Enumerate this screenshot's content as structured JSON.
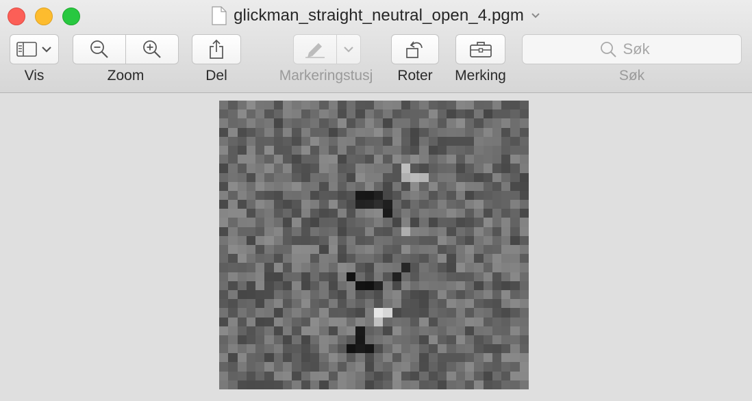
{
  "window": {
    "title": "glickman_straight_neutral_open_4.pgm"
  },
  "toolbar": {
    "vis_label": "Vis",
    "zoom_label": "Zoom",
    "del_label": "Del",
    "markup_pen_label": "Markeringstusj",
    "rotate_label": "Roter",
    "markup_label": "Merking",
    "search_label": "Søk"
  },
  "search": {
    "placeholder": "Søk"
  },
  "icons": [
    "document-icon",
    "title-chevron-icon",
    "sidebar-icon",
    "chevron-down-icon",
    "zoom-out-icon",
    "zoom-in-icon",
    "share-icon",
    "pen-icon",
    "rotate-icon",
    "toolbox-icon",
    "search-icon"
  ],
  "colors": {
    "close": "#fc5f57",
    "minimize": "#fdbc2e",
    "maximize": "#28c840"
  }
}
